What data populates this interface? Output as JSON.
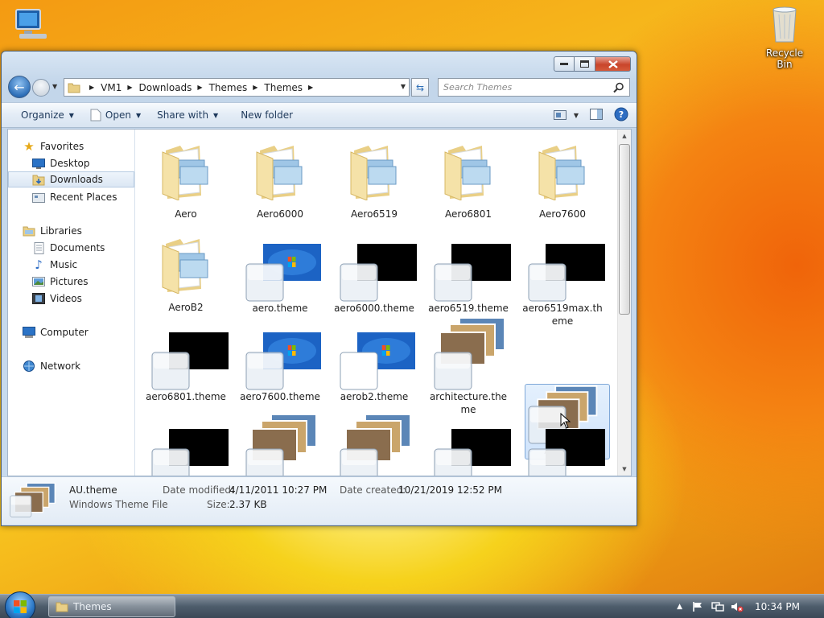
{
  "desktop": {
    "recycle_bin_label": "Recycle Bin"
  },
  "window": {
    "breadcrumb": [
      "VM1",
      "Downloads",
      "Themes",
      "Themes"
    ],
    "search_placeholder": "Search Themes",
    "toolbar": {
      "organize": "Organize",
      "open": "Open",
      "share_with": "Share with",
      "new_folder": "New folder"
    },
    "nav": {
      "favorites": "Favorites",
      "desktop": "Desktop",
      "downloads": "Downloads",
      "recent_places": "Recent Places",
      "libraries": "Libraries",
      "documents": "Documents",
      "music": "Music",
      "pictures": "Pictures",
      "videos": "Videos",
      "computer": "Computer",
      "network": "Network"
    },
    "items": [
      "Aero",
      "Aero6000",
      "Aero6519",
      "Aero6801",
      "Aero7600",
      "AeroB2",
      "aero.theme",
      "aero6000.theme",
      "aero6519.theme",
      "aero6519max.theme",
      "aero6801.theme",
      "aero7600.theme",
      "aerob2.theme",
      "architecture.theme",
      "AU.theme"
    ],
    "details": {
      "name": "AU.theme",
      "type": "Windows Theme File",
      "date_modified_label": "Date modified:",
      "date_modified": "4/11/2011 10:27 PM",
      "date_created_label": "Date created:",
      "date_created": "10/21/2019 12:52 PM",
      "size_label": "Size:",
      "size": "2.37 KB"
    }
  },
  "taskbar": {
    "task_label": "Themes",
    "clock": "10:34 PM"
  },
  "colors": {
    "accent": "#2e6fb8",
    "selection": "#cfe3fb",
    "close_button": "#c9452b"
  }
}
